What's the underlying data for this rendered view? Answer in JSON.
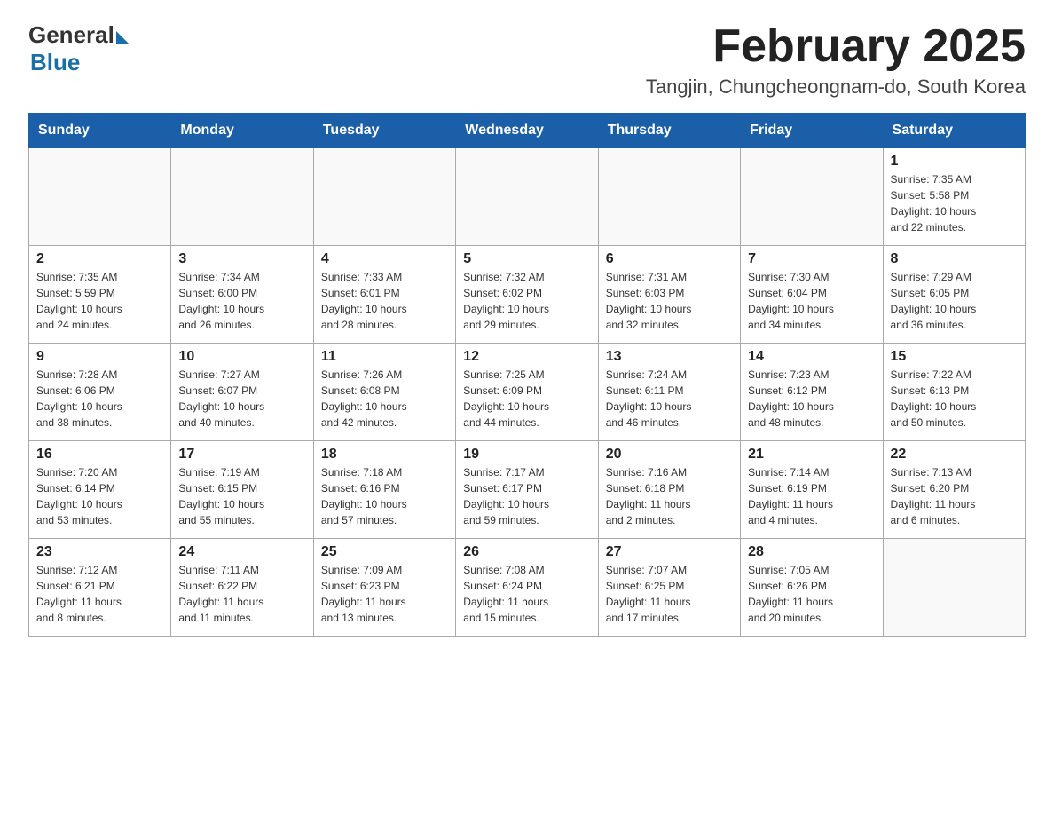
{
  "logo": {
    "general": "General",
    "blue": "Blue"
  },
  "title": "February 2025",
  "location": "Tangjin, Chungcheongnam-do, South Korea",
  "days_of_week": [
    "Sunday",
    "Monday",
    "Tuesday",
    "Wednesday",
    "Thursday",
    "Friday",
    "Saturday"
  ],
  "weeks": [
    [
      {
        "day": "",
        "info": ""
      },
      {
        "day": "",
        "info": ""
      },
      {
        "day": "",
        "info": ""
      },
      {
        "day": "",
        "info": ""
      },
      {
        "day": "",
        "info": ""
      },
      {
        "day": "",
        "info": ""
      },
      {
        "day": "1",
        "info": "Sunrise: 7:35 AM\nSunset: 5:58 PM\nDaylight: 10 hours\nand 22 minutes."
      }
    ],
    [
      {
        "day": "2",
        "info": "Sunrise: 7:35 AM\nSunset: 5:59 PM\nDaylight: 10 hours\nand 24 minutes."
      },
      {
        "day": "3",
        "info": "Sunrise: 7:34 AM\nSunset: 6:00 PM\nDaylight: 10 hours\nand 26 minutes."
      },
      {
        "day": "4",
        "info": "Sunrise: 7:33 AM\nSunset: 6:01 PM\nDaylight: 10 hours\nand 28 minutes."
      },
      {
        "day": "5",
        "info": "Sunrise: 7:32 AM\nSunset: 6:02 PM\nDaylight: 10 hours\nand 29 minutes."
      },
      {
        "day": "6",
        "info": "Sunrise: 7:31 AM\nSunset: 6:03 PM\nDaylight: 10 hours\nand 32 minutes."
      },
      {
        "day": "7",
        "info": "Sunrise: 7:30 AM\nSunset: 6:04 PM\nDaylight: 10 hours\nand 34 minutes."
      },
      {
        "day": "8",
        "info": "Sunrise: 7:29 AM\nSunset: 6:05 PM\nDaylight: 10 hours\nand 36 minutes."
      }
    ],
    [
      {
        "day": "9",
        "info": "Sunrise: 7:28 AM\nSunset: 6:06 PM\nDaylight: 10 hours\nand 38 minutes."
      },
      {
        "day": "10",
        "info": "Sunrise: 7:27 AM\nSunset: 6:07 PM\nDaylight: 10 hours\nand 40 minutes."
      },
      {
        "day": "11",
        "info": "Sunrise: 7:26 AM\nSunset: 6:08 PM\nDaylight: 10 hours\nand 42 minutes."
      },
      {
        "day": "12",
        "info": "Sunrise: 7:25 AM\nSunset: 6:09 PM\nDaylight: 10 hours\nand 44 minutes."
      },
      {
        "day": "13",
        "info": "Sunrise: 7:24 AM\nSunset: 6:11 PM\nDaylight: 10 hours\nand 46 minutes."
      },
      {
        "day": "14",
        "info": "Sunrise: 7:23 AM\nSunset: 6:12 PM\nDaylight: 10 hours\nand 48 minutes."
      },
      {
        "day": "15",
        "info": "Sunrise: 7:22 AM\nSunset: 6:13 PM\nDaylight: 10 hours\nand 50 minutes."
      }
    ],
    [
      {
        "day": "16",
        "info": "Sunrise: 7:20 AM\nSunset: 6:14 PM\nDaylight: 10 hours\nand 53 minutes."
      },
      {
        "day": "17",
        "info": "Sunrise: 7:19 AM\nSunset: 6:15 PM\nDaylight: 10 hours\nand 55 minutes."
      },
      {
        "day": "18",
        "info": "Sunrise: 7:18 AM\nSunset: 6:16 PM\nDaylight: 10 hours\nand 57 minutes."
      },
      {
        "day": "19",
        "info": "Sunrise: 7:17 AM\nSunset: 6:17 PM\nDaylight: 10 hours\nand 59 minutes."
      },
      {
        "day": "20",
        "info": "Sunrise: 7:16 AM\nSunset: 6:18 PM\nDaylight: 11 hours\nand 2 minutes."
      },
      {
        "day": "21",
        "info": "Sunrise: 7:14 AM\nSunset: 6:19 PM\nDaylight: 11 hours\nand 4 minutes."
      },
      {
        "day": "22",
        "info": "Sunrise: 7:13 AM\nSunset: 6:20 PM\nDaylight: 11 hours\nand 6 minutes."
      }
    ],
    [
      {
        "day": "23",
        "info": "Sunrise: 7:12 AM\nSunset: 6:21 PM\nDaylight: 11 hours\nand 8 minutes."
      },
      {
        "day": "24",
        "info": "Sunrise: 7:11 AM\nSunset: 6:22 PM\nDaylight: 11 hours\nand 11 minutes."
      },
      {
        "day": "25",
        "info": "Sunrise: 7:09 AM\nSunset: 6:23 PM\nDaylight: 11 hours\nand 13 minutes."
      },
      {
        "day": "26",
        "info": "Sunrise: 7:08 AM\nSunset: 6:24 PM\nDaylight: 11 hours\nand 15 minutes."
      },
      {
        "day": "27",
        "info": "Sunrise: 7:07 AM\nSunset: 6:25 PM\nDaylight: 11 hours\nand 17 minutes."
      },
      {
        "day": "28",
        "info": "Sunrise: 7:05 AM\nSunset: 6:26 PM\nDaylight: 11 hours\nand 20 minutes."
      },
      {
        "day": "",
        "info": ""
      }
    ]
  ]
}
